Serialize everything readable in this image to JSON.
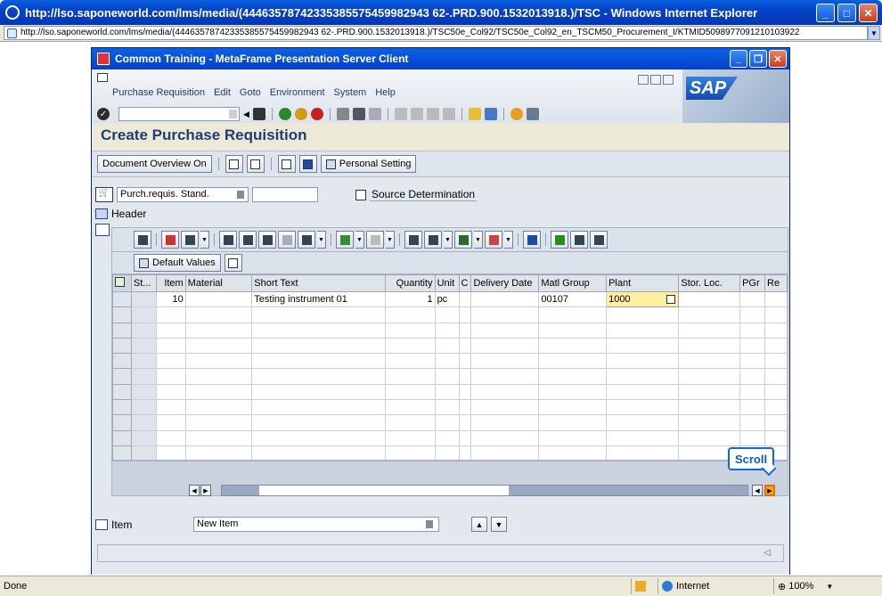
{
  "browser": {
    "title": "http://lso.saponeworld.com/lms/media/(44463578742335385575459982943 62-.PRD.900.1532013918.)/TSC - Windows Internet Explorer",
    "address": "http://lso.saponeworld.com/lms/media/(44463578742335385575459982943 62-.PRD.900.1532013918.)/TSC50e_Col92/TSC50e_Col92_en_TSCM50_Procurement_I/KTMID509897709121010392​2",
    "status_text": "Done",
    "zone": "Internet",
    "zoom": "100%"
  },
  "citrix": {
    "title": "Common Training - MetaFrame Presentation Server Client"
  },
  "menu": [
    "Purchase Requisition",
    "Edit",
    "Goto",
    "Environment",
    "System",
    "Help"
  ],
  "screen_title": "Create Purchase Requisition",
  "app_toolbar": {
    "doc_overview": "Document Overview On",
    "personal_setting": "Personal Setting"
  },
  "header": {
    "doc_type": "Purch.requis. Stand.",
    "source_determination": "Source Determination",
    "header_label": "Header"
  },
  "grid": {
    "default_values": "Default Values",
    "columns": [
      "St...",
      "Item",
      "Material",
      "Short Text",
      "Quantity",
      "Unit",
      "C",
      "Delivery Date",
      "Matl Group",
      "Plant",
      "Stor. Loc.",
      "PGr",
      "Re"
    ],
    "rows": [
      {
        "item": "10",
        "material": "",
        "short_text": "Testing instrument 01",
        "quantity": "1",
        "unit": "pc",
        "c": "",
        "delivery_date": "",
        "matl_group": "00107",
        "plant": "1000",
        "stor_loc": "",
        "pgr": ""
      }
    ]
  },
  "scroll_tip": "Scroll",
  "item_section": {
    "label": "Item",
    "value": "New Item"
  }
}
